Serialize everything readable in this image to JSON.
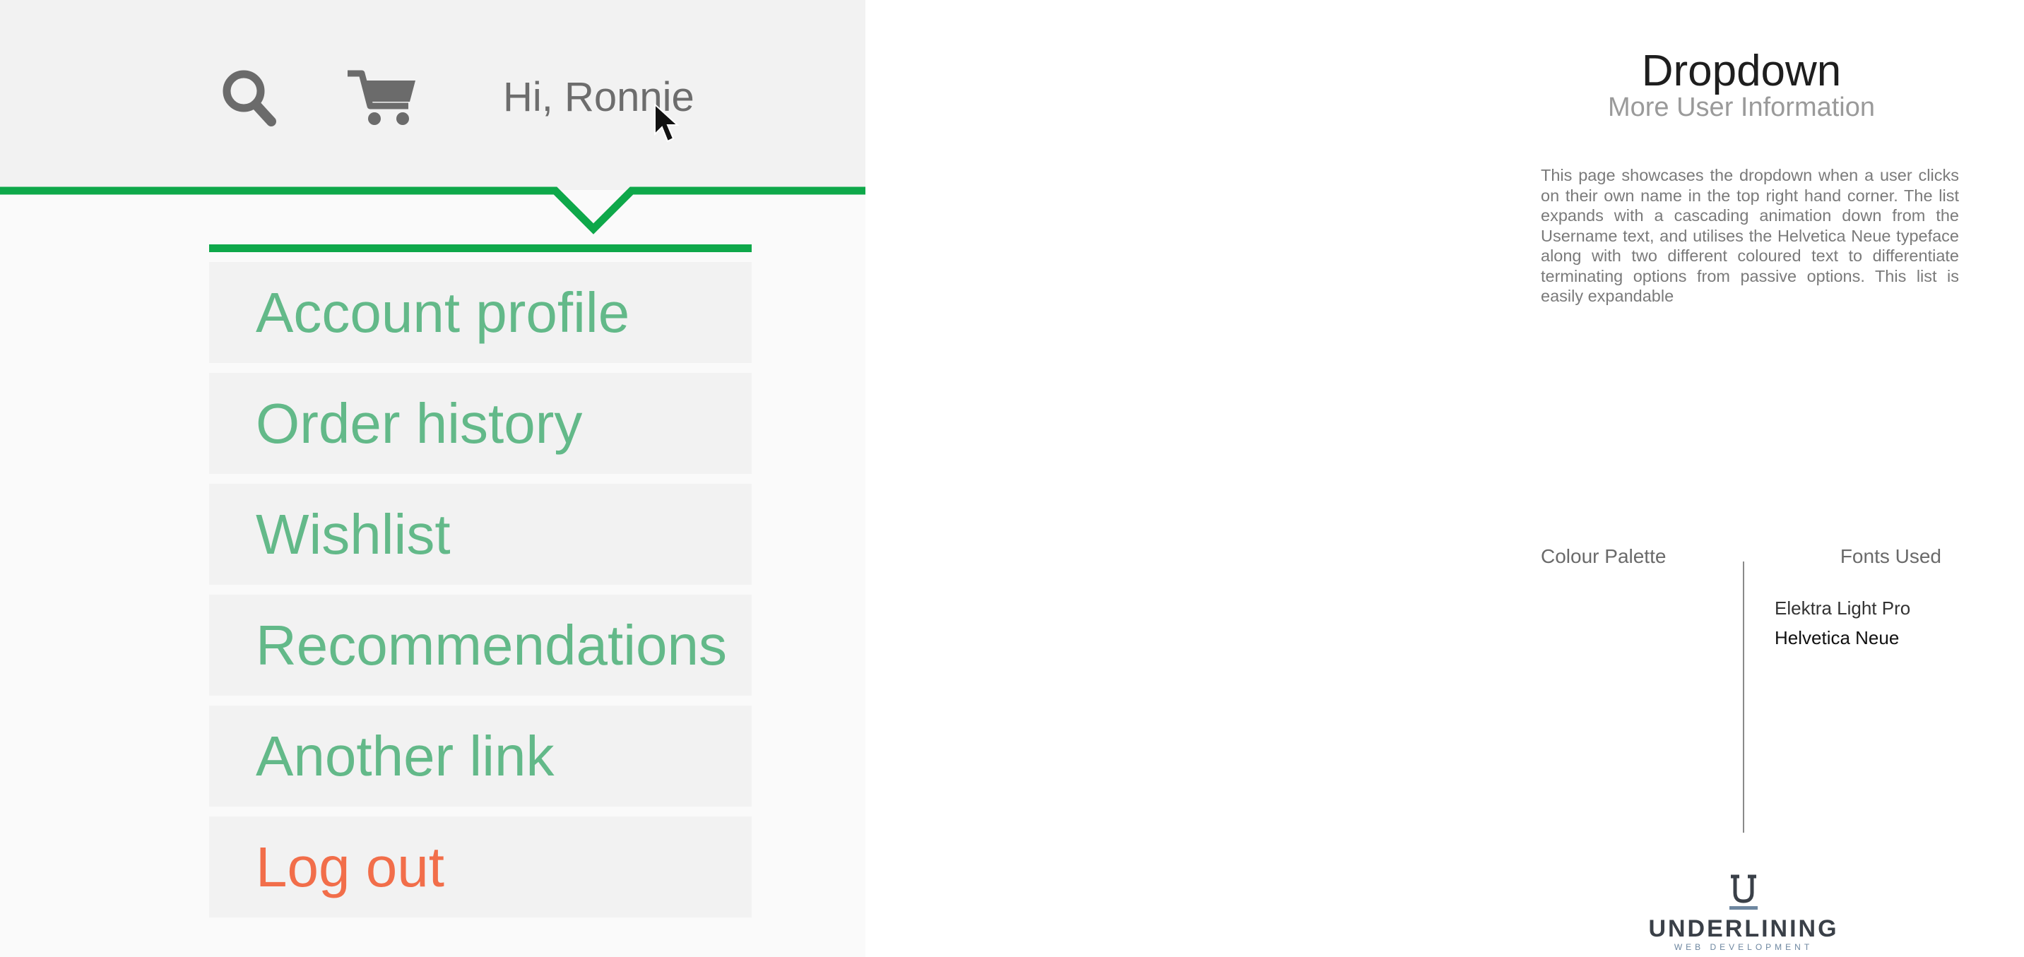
{
  "header": {
    "search_icon": "search-icon",
    "cart_icon": "cart-icon",
    "greeting": "Hi, Ronnie"
  },
  "dropdown": {
    "items": [
      {
        "label": "Account profile"
      },
      {
        "label": "Order history"
      },
      {
        "label": "Wishlist"
      },
      {
        "label": "Recommendations"
      },
      {
        "label": "Another link"
      },
      {
        "label": "Log out"
      }
    ]
  },
  "info": {
    "title": "Dropdown",
    "subtitle": "More User Information",
    "description": "This page showcases the dropdown when a user clicks on their own name in the top right hand corner.  The list expands with a cascading animation down from the Username text, and utilises the Helvetica Neue typeface along with two different coloured text to differentiate terminating options from passive options.  This list is easily expandable",
    "palette_heading": "Colour Palette",
    "fonts_heading": "Fonts Used",
    "fonts": [
      "Elektra Light Pro",
      "Helvetica Neue"
    ]
  },
  "logo": {
    "mark": "U",
    "name": "UNDERLINING",
    "tagline": "WEB DEVELOPMENT"
  },
  "colors": {
    "accent_green": "#0ea84a",
    "link_green": "#63b989",
    "logout_orange": "#f26e4a",
    "header_bg": "#f2f2f2"
  }
}
